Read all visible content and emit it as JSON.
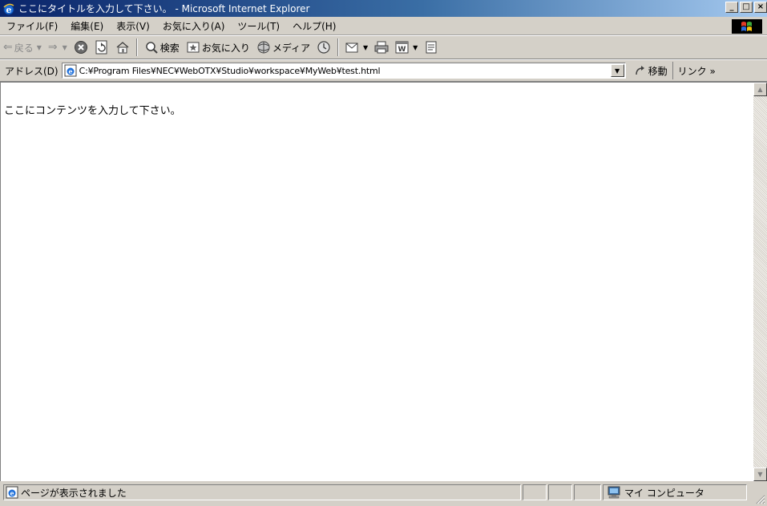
{
  "window": {
    "title": "ここにタイトルを入力して下さい。 - Microsoft Internet Explorer",
    "minimize": "_",
    "maximize": "□",
    "close": "×"
  },
  "menu": {
    "items": [
      {
        "label": "ファイル(F)"
      },
      {
        "label": "編集(E)"
      },
      {
        "label": "表示(V)"
      },
      {
        "label": "お気に入り(A)"
      },
      {
        "label": "ツール(T)"
      },
      {
        "label": "ヘルプ(H)"
      }
    ]
  },
  "toolbar": {
    "back": "戻る",
    "search": "検索",
    "favorites": "お気に入り",
    "media": "メディア"
  },
  "address": {
    "label": "アドレス(D)",
    "url": "C:¥Program Files¥NEC¥WebOTX¥Studio¥workspace¥MyWeb¥test.html",
    "go": "移動",
    "links": "リンク »"
  },
  "content": {
    "text": "ここにコンテンツを入力して下さい。"
  },
  "status": {
    "text": "ページが表示されました",
    "zone": "マイ コンピュータ"
  },
  "colors": {
    "titlebar_start": "#0a246a",
    "titlebar_end": "#a6caf0",
    "chrome": "#d4d0c8"
  }
}
